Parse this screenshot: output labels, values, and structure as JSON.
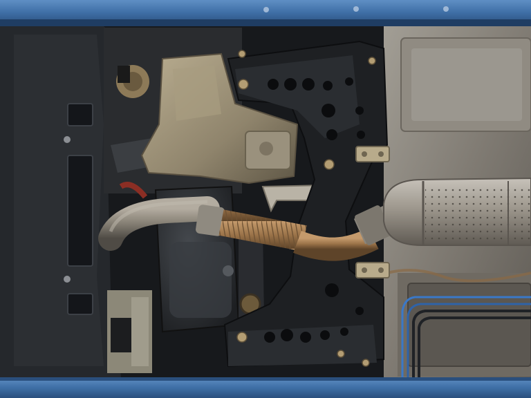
{
  "image": {
    "subject": "car-underside",
    "palette": {
      "frame_blue": "#3f6fa6",
      "frame_blue_dark": "#2a4f7d",
      "splash_shield": "#2b2e33",
      "subframe_black": "#1c1e21",
      "heat_shield": "#8d8a84",
      "exhaust_pipe": "#8a8478",
      "flex_pipe": "#a07b55",
      "gearbox": "#9b9078",
      "oil_pan": "#2c2f33",
      "brake_line": "#3a78c8",
      "bolt": "#b8a27a"
    }
  }
}
